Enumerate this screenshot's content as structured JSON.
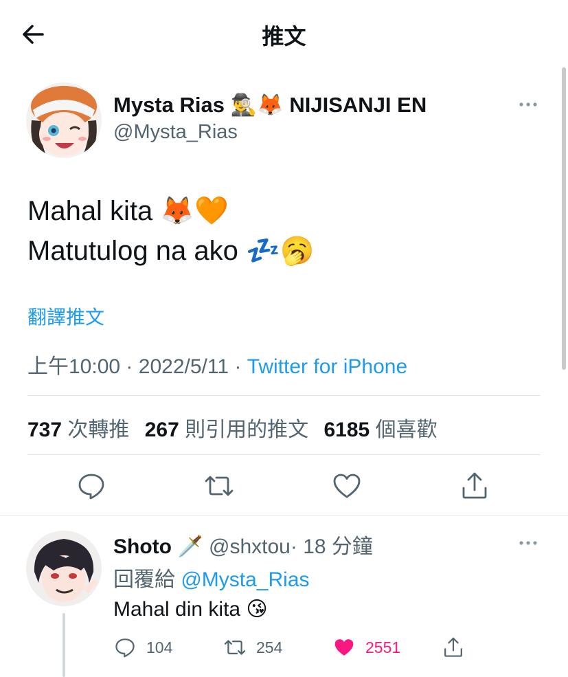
{
  "header": {
    "title": "推文"
  },
  "tweet": {
    "display_name": "Mysta Rias 🕵️‍♂️🦊 NIJISANJI EN",
    "handle": "@Mysta_Rias",
    "text_line1": "Mahal kita 🦊🧡",
    "text_line2": "Matutulog na ako 💤🥱",
    "translate_label": "翻譯推文",
    "time": "上午10:00",
    "date": "2022/5/11",
    "separator": "·",
    "source": "Twitter for iPhone",
    "stats": {
      "retweets": "737",
      "retweets_label": "次轉推",
      "quotes": "267",
      "quotes_label": "則引用的推文",
      "likes": "6185",
      "likes_label": "個喜歡"
    }
  },
  "reply": {
    "display_name": "Shoto 🗡️",
    "handle": "@shxtou",
    "separator": "·",
    "time_ago": "18 分鐘",
    "replying_to_label": "回覆給",
    "replying_to_handle": "@Mysta_Rias",
    "text": "Mahal din kita 😘",
    "reply_count": "104",
    "retweet_count": "254",
    "like_count": "2551"
  },
  "colors": {
    "accent": "#1d9bf0",
    "secondary_text": "#536471",
    "like": "#f91880",
    "divider": "#e1e4e8"
  },
  "icons": [
    "back-arrow-icon",
    "more-icon",
    "reply-icon",
    "retweet-icon",
    "like-icon",
    "share-icon"
  ]
}
